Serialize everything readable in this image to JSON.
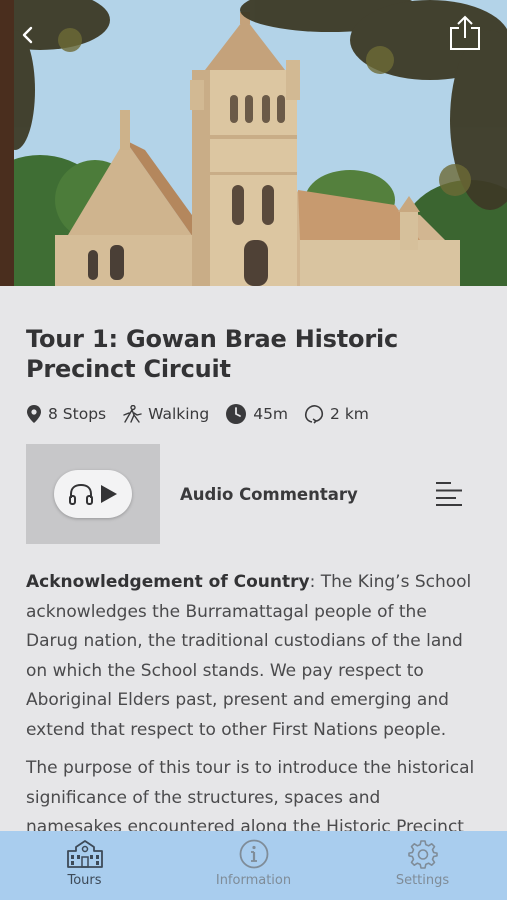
{
  "header": {
    "hero_image": "Gowan Brae historic chapel with sandstone bell tower",
    "back_icon": "chevron-left-icon",
    "share_icon": "share-icon"
  },
  "tour": {
    "title": "Tour 1: Gowan Brae Historic Precinct Circuit",
    "stops": "8 Stops",
    "mode": "Walking",
    "duration": "45m",
    "distance": "2 km"
  },
  "audio": {
    "label": "Audio Commentary"
  },
  "body": {
    "ack_heading": "Acknowledgement of Country",
    "ack_text": ": The King’s School acknowledges the Burramattagal people of the Darug nation, the traditional custodians of the land on which the School stands. We pay respect to Aboriginal Elders past, present and emerging and extend that respect to other First Nations people.",
    "purpose_text": "The purpose of this tour is to introduce the historical significance of the structures, spaces and namesakes encountered along the Historic Precinct"
  },
  "tabbar": {
    "tabs": [
      {
        "label": "Tours",
        "icon": "school-building-icon",
        "active": true
      },
      {
        "label": "Information",
        "icon": "info-icon",
        "active": false
      },
      {
        "label": "Settings",
        "icon": "gear-icon",
        "active": false
      }
    ]
  },
  "colors": {
    "background": "#e6e6e8",
    "tabbar": "#a9cdee",
    "audio_thumb": "#c7c7c9",
    "text": "#3a3a3c"
  }
}
